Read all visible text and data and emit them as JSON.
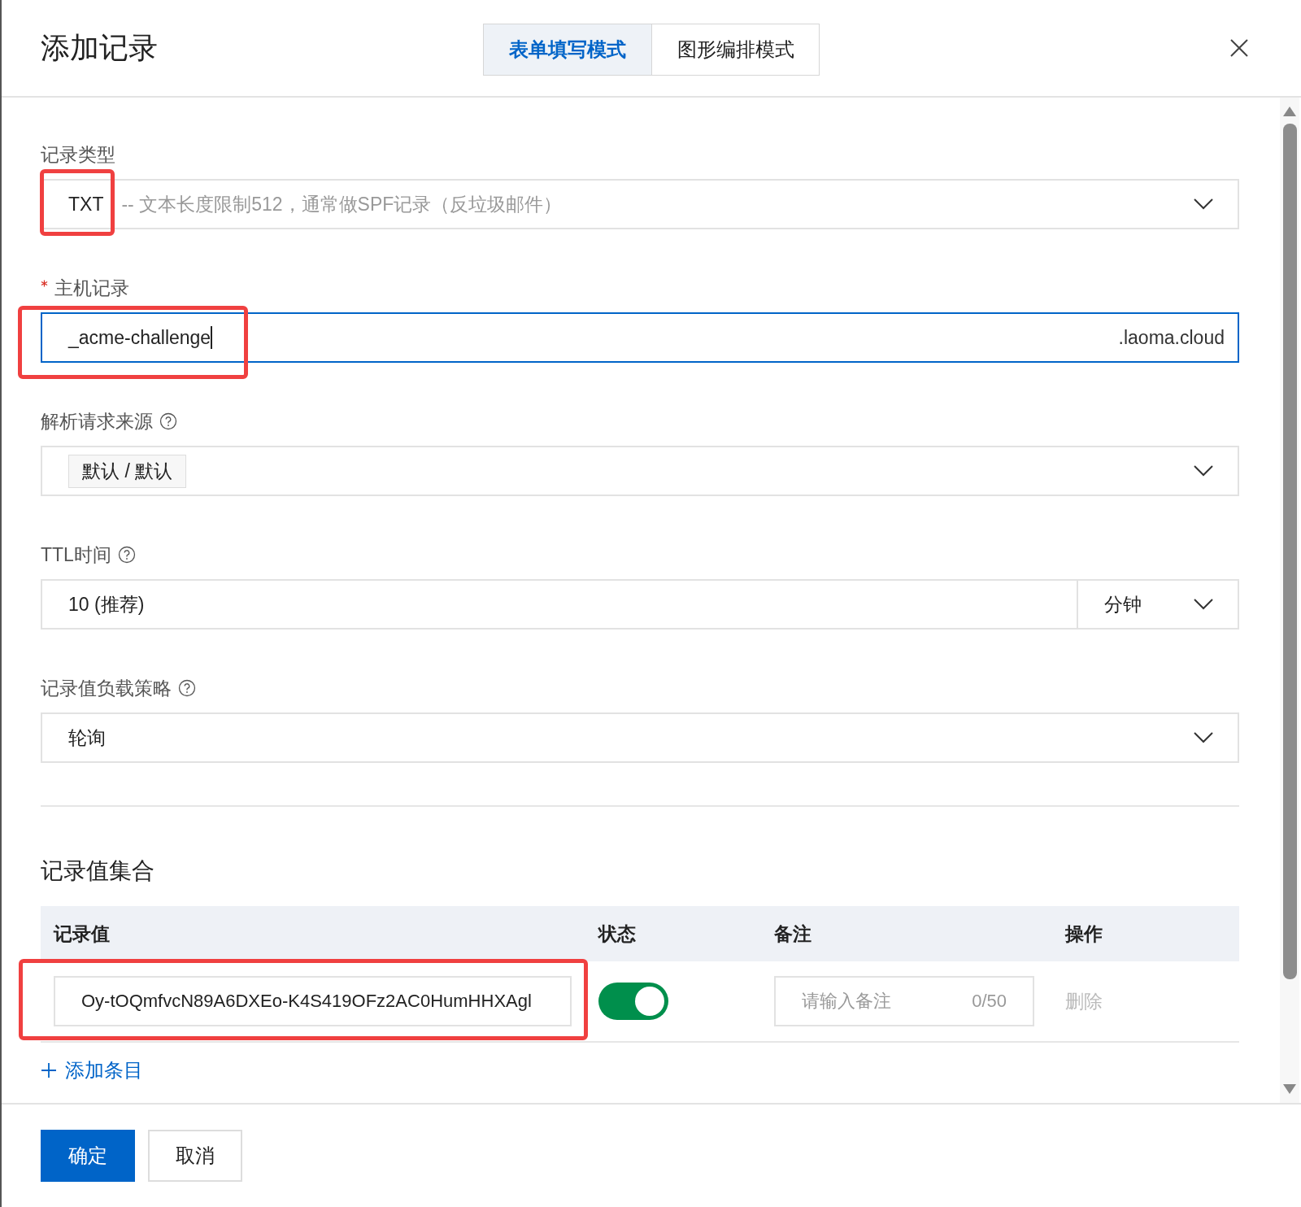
{
  "dialog": {
    "title": "添加记录"
  },
  "mode_tabs": [
    {
      "label": "表单填写模式",
      "selected": true
    },
    {
      "label": "图形编排模式",
      "selected": false
    }
  ],
  "fields": [
    {
      "kind": "select",
      "label": "记录类型",
      "required": false,
      "help": false,
      "highlighted": true,
      "value": "TXT",
      "hint": "-- 文本长度限制512，通常做SPF记录（反垃圾邮件）"
    },
    {
      "kind": "text",
      "label": "主机记录",
      "required": true,
      "help": false,
      "highlighted": true,
      "focused": true,
      "value": "_acme-challenge",
      "suffix": ".laoma.cloud"
    },
    {
      "kind": "tag-select",
      "label": "解析请求来源",
      "required": false,
      "help": true,
      "tag": "默认 / 默认"
    },
    {
      "kind": "number-unit",
      "label": "TTL时间",
      "required": false,
      "help": true,
      "value": "10 (推荐)",
      "unit": "分钟"
    },
    {
      "kind": "select",
      "label": "记录值负载策略",
      "required": false,
      "help": true,
      "value": "轮询"
    }
  ],
  "record_set": {
    "title": "记录值集合",
    "columns": [
      "记录值",
      "状态",
      "备注",
      "操作"
    ],
    "rows": [
      {
        "value": "Oy-tOQmfvcN89A6DXEo-K4S419OFz2AC0HumHHXAgl",
        "highlighted": true,
        "on": true,
        "note_placeholder": "请输入备注",
        "note_count": "0/50",
        "action": "删除",
        "action_disabled": true
      }
    ],
    "add_label": "添加条目"
  },
  "footer": {
    "buttons": [
      {
        "label": "确定",
        "kind": "primary"
      },
      {
        "label": "取消",
        "kind": "default"
      }
    ]
  }
}
